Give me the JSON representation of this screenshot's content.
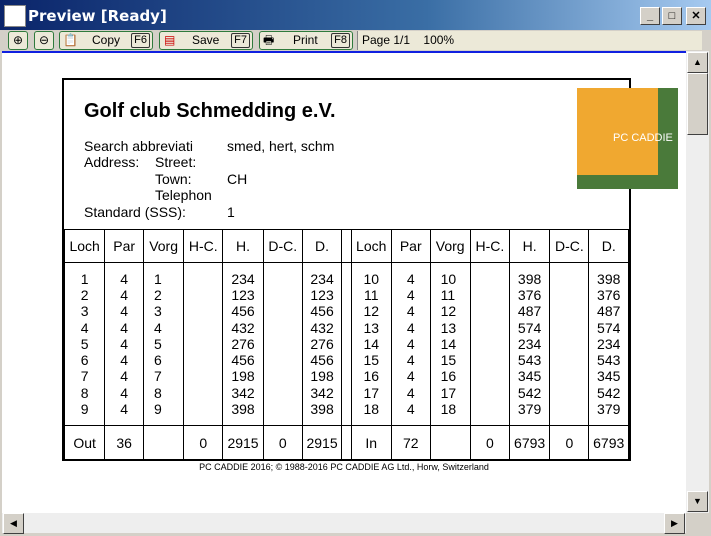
{
  "window": {
    "title": "Preview [Ready]"
  },
  "toolbar": {
    "copy": "Copy",
    "copy_key": "F6",
    "save": "Save",
    "save_key": "F7",
    "print": "Print",
    "print_key": "F8",
    "page": "Page 1/1",
    "zoom": "100%"
  },
  "report": {
    "title": "Golf club Schmedding e.V.",
    "search_label": "Search abbreviati",
    "search_value": "smed, hert, schm",
    "address_label": "Address:",
    "street_label": "Street:",
    "town_label": "Town:",
    "town_value": "CH",
    "telephone_label": "Telephon",
    "sss_label": "Standard (SSS):",
    "sss_value": "1",
    "logo_text": "PC CADDIE",
    "headers": [
      "Loch",
      "Par",
      "Vorg",
      "H-C.",
      "H.",
      "D-C.",
      "D."
    ],
    "front": {
      "loch": [
        "1",
        "2",
        "3",
        "4",
        "5",
        "6",
        "7",
        "8",
        "9"
      ],
      "par": [
        "4",
        "4",
        "4",
        "4",
        "4",
        "4",
        "4",
        "4",
        "4"
      ],
      "vorg": [
        "1",
        "2",
        "3",
        "4",
        "5",
        "6",
        "7",
        "8",
        "9"
      ],
      "h": [
        "234",
        "123",
        "456",
        "432",
        "276",
        "456",
        "198",
        "342",
        "398"
      ],
      "d": [
        "234",
        "123",
        "456",
        "432",
        "276",
        "456",
        "198",
        "342",
        "398"
      ]
    },
    "back": {
      "loch": [
        "10",
        "11",
        "12",
        "13",
        "14",
        "15",
        "16",
        "17",
        "18"
      ],
      "par": [
        "4",
        "4",
        "4",
        "4",
        "4",
        "4",
        "4",
        "4",
        "4"
      ],
      "vorg": [
        "10",
        "11",
        "12",
        "13",
        "14",
        "15",
        "16",
        "17",
        "18"
      ],
      "h": [
        "398",
        "376",
        "487",
        "574",
        "234",
        "543",
        "345",
        "542",
        "379"
      ],
      "d": [
        "398",
        "376",
        "487",
        "574",
        "234",
        "543",
        "345",
        "542",
        "379"
      ]
    },
    "out": {
      "label": "Out",
      "par": "36",
      "hc": "0",
      "h": "2915",
      "dc": "0",
      "d": "2915"
    },
    "in": {
      "label": "In",
      "par": "72",
      "hc": "0",
      "h": "6793",
      "dc": "0",
      "d": "6793"
    },
    "footer": "PC CADDIE 2016; © 1988-2016 PC CADDIE AG Ltd., Horw, Switzerland"
  }
}
